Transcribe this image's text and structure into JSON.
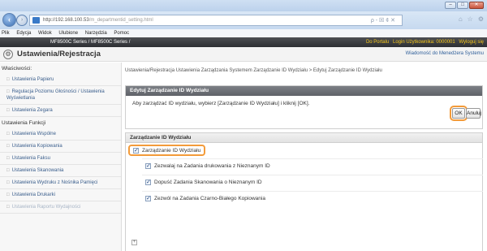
{
  "browser": {
    "url_host": "http://192.168.100.53",
    "url_path": "/m_departmentid_setting.html",
    "url_tools": "ρ - ☒ ¢ ✕",
    "menu": [
      "Plik",
      "Edycja",
      "Widok",
      "Ulubione",
      "Narzędzia",
      "Pomoc"
    ],
    "window_min": "–",
    "window_max": "□",
    "window_close": "✕"
  },
  "device": {
    "model": "MF8500C Series / MF8500C Series /",
    "portal": "Do Portalu",
    "login": "Login Użytkownika: 0000001",
    "logout": "Wyloguj się"
  },
  "page": {
    "title": "Ustawienia/Rejestracja",
    "admin_message": "Wiadomość do Menedżera Systemu"
  },
  "sidebar": {
    "group1": "Właściwości:",
    "items1": [
      {
        "label": "Ustawienia Papieru"
      },
      {
        "label": "Regulacja Poziomu Głośności / Ustawienia Wyświetlania"
      },
      {
        "label": "Ustawienia Zegara"
      }
    ],
    "group2": "Ustawienia Funkcji",
    "items2": [
      {
        "label": "Ustawienia Wspólne"
      },
      {
        "label": "Ustawienia Kopiowania"
      },
      {
        "label": "Ustawienia Faksu"
      },
      {
        "label": "Ustawienia Skanowania"
      },
      {
        "label": "Ustawienia Wydruku z Nośnika Pamięci"
      },
      {
        "label": "Ustawienia Drukarki"
      },
      {
        "label": "Ustawienia Raportu Wydajności"
      }
    ]
  },
  "main": {
    "breadcrumb": "Ustawienia/Rejestracja Ustawienia Zarządzania Systemem Zarządzanie ID Wydziału > Edytuj Zarządzanie ID Wydziału",
    "edit_panel_title": "Edytuj Zarządzanie ID Wydziału",
    "instruction": "Aby zarządzać ID wydziału, wybierz [Zarządzanie ID Wydziału] i kliknij [OK].",
    "ok_label": "OK",
    "cancel_label": "Anuluj",
    "section_title": "Zarządzanie ID Wydziału",
    "main_option": "Zarządzanie ID Wydziału",
    "options": [
      "Zezwalaj na Zadania drukowania z Nieznanym ID",
      "Dopuść Zadania Skanowania o Nieznanym ID",
      "Zezwól na Zadania Czarno-Białego Kopiowania"
    ],
    "expander": "+"
  },
  "colors": {
    "highlight": "#f39b3a",
    "link": "#3a5e8c",
    "header_dark": "#2d2f33"
  }
}
